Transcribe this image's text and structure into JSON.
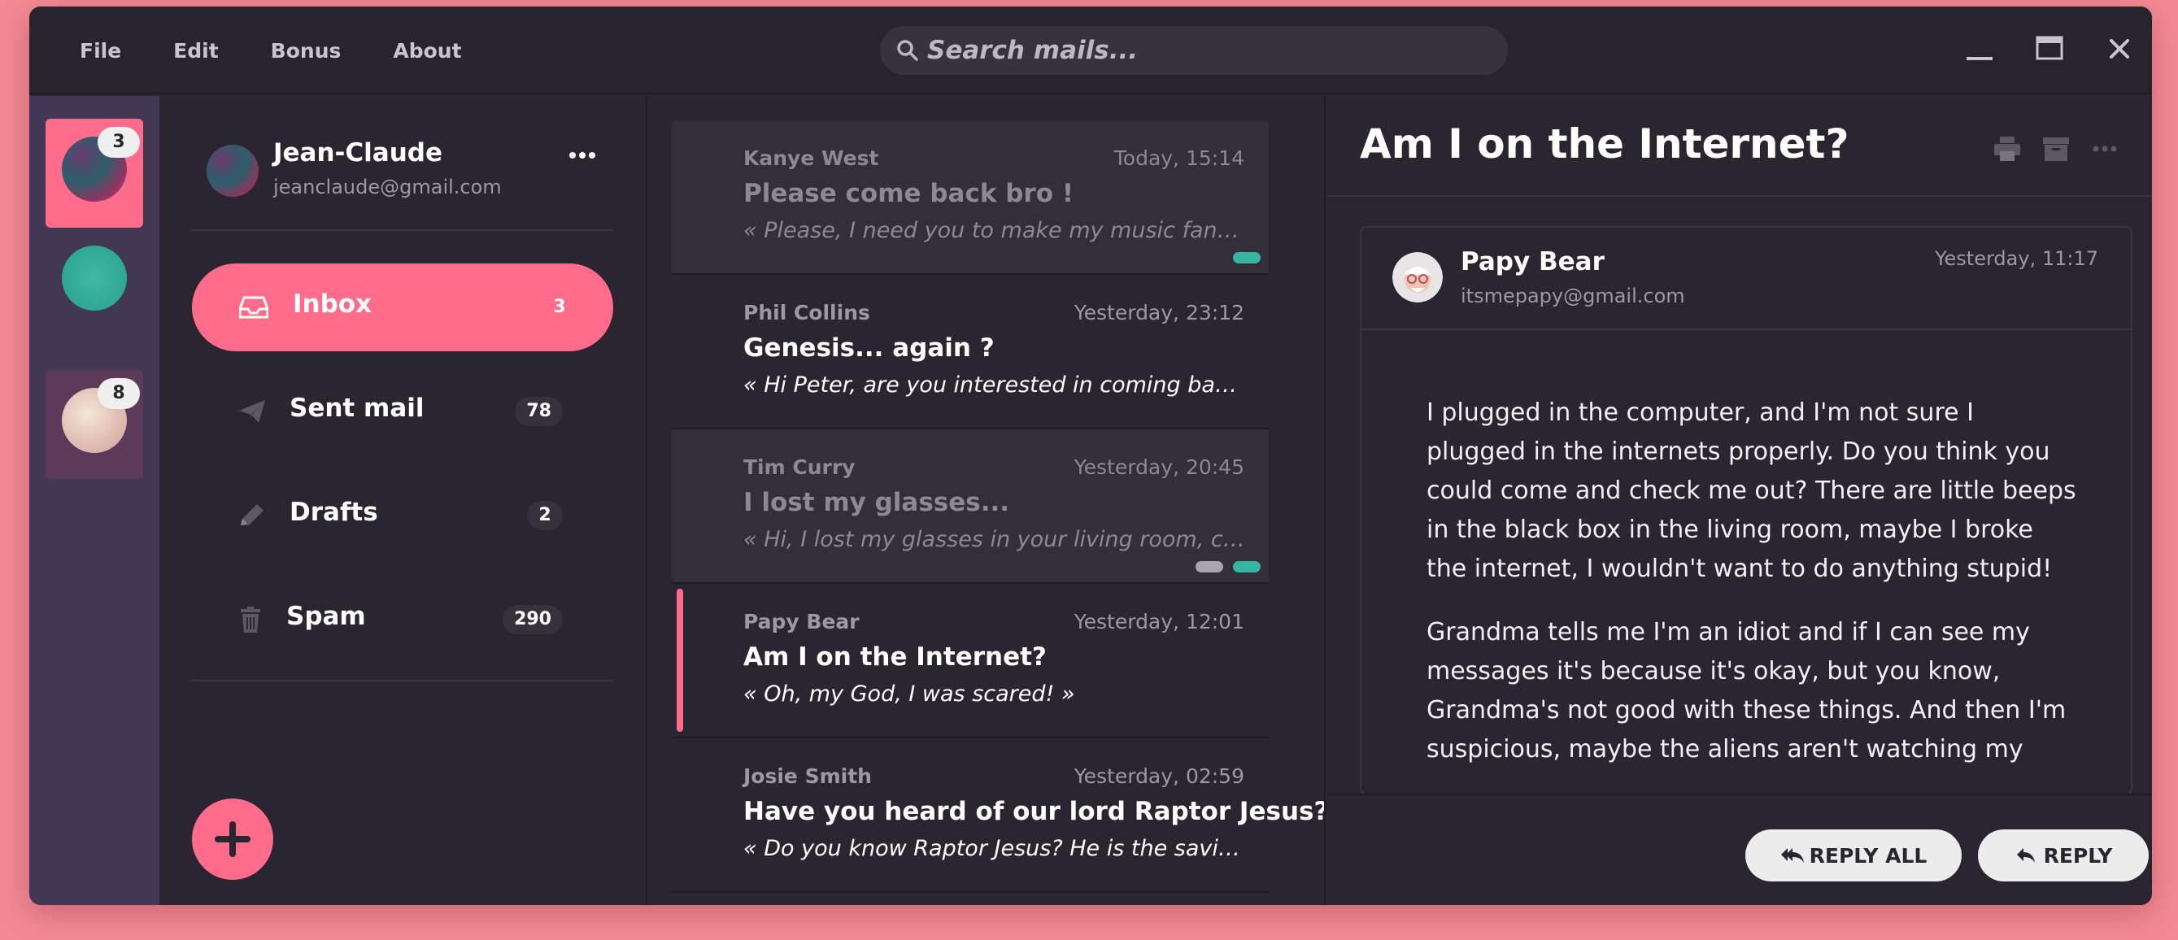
{
  "menu": {
    "file": "File",
    "edit": "Edit",
    "bonus": "Bonus",
    "about": "About"
  },
  "search": {
    "placeholder": "Search mails..."
  },
  "accounts": [
    {
      "badge": "3",
      "active": true
    },
    {
      "badge": "",
      "active": false
    },
    {
      "badge": "8",
      "active": false
    }
  ],
  "user": {
    "name": "Jean-Claude",
    "email": "jeanclaude@gmail.com"
  },
  "folders": [
    {
      "label": "Inbox",
      "count": "3",
      "icon": "inbox-icon"
    },
    {
      "label": "Sent mail",
      "count": "78",
      "icon": "paper-plane-icon"
    },
    {
      "label": "Drafts",
      "count": "2",
      "icon": "pencil-icon"
    },
    {
      "label": "Spam",
      "count": "290",
      "icon": "trash-icon"
    }
  ],
  "mails": [
    {
      "from": "Kanye West",
      "time": "Today, 15:14",
      "subject": "Please come back bro !",
      "preview": "« Please, I need you to make my music fantastic again »"
    },
    {
      "from": "Phil Collins",
      "time": "Yesterday, 23:12",
      "subject": "Genesis... again ?",
      "preview": "« Hi Peter, are you interested in coming back to the band? »"
    },
    {
      "from": "Tim Curry",
      "time": "Yesterday, 20:45",
      "subject": "I lost my glasses...",
      "preview": "« Hi, I lost my glasses in your living room, could you check? »"
    },
    {
      "from": "Papy Bear",
      "time": "Yesterday, 12:01",
      "subject": "Am I on the Internet?",
      "preview": "« Oh, my God, I was scared! »"
    },
    {
      "from": "Josie Smith",
      "time": "Yesterday, 02:59",
      "subject": "Have you heard of our lord Raptor Jesus?",
      "preview": "« Do you know Raptor Jesus? He is the savior of our souls »"
    }
  ],
  "reader": {
    "title": "Am I on the Internet?",
    "sender_name": "Papy Bear",
    "sender_email": "itsmepapy@gmail.com",
    "time": "Yesterday, 11:17",
    "paragraph1": "I plugged in the computer, and I'm not sure I plugged in the internets properly. Do you think you could come and check me out? There are little beeps in the black box in the living room, maybe I broke the internet, I wouldn't want to do anything stupid!",
    "paragraph2": "Grandma tells me I'm an idiot and if I can see my messages it's because it's okay, but you know, Grandma's not good with these things. And then I'm suspicious, maybe the aliens aren't watching my",
    "reply_all": "REPLY ALL",
    "reply": "REPLY"
  },
  "colors": {
    "accent": "#ff6b8a",
    "teal": "#36b5a2",
    "rail": "#423754",
    "window": "#2a2530"
  }
}
